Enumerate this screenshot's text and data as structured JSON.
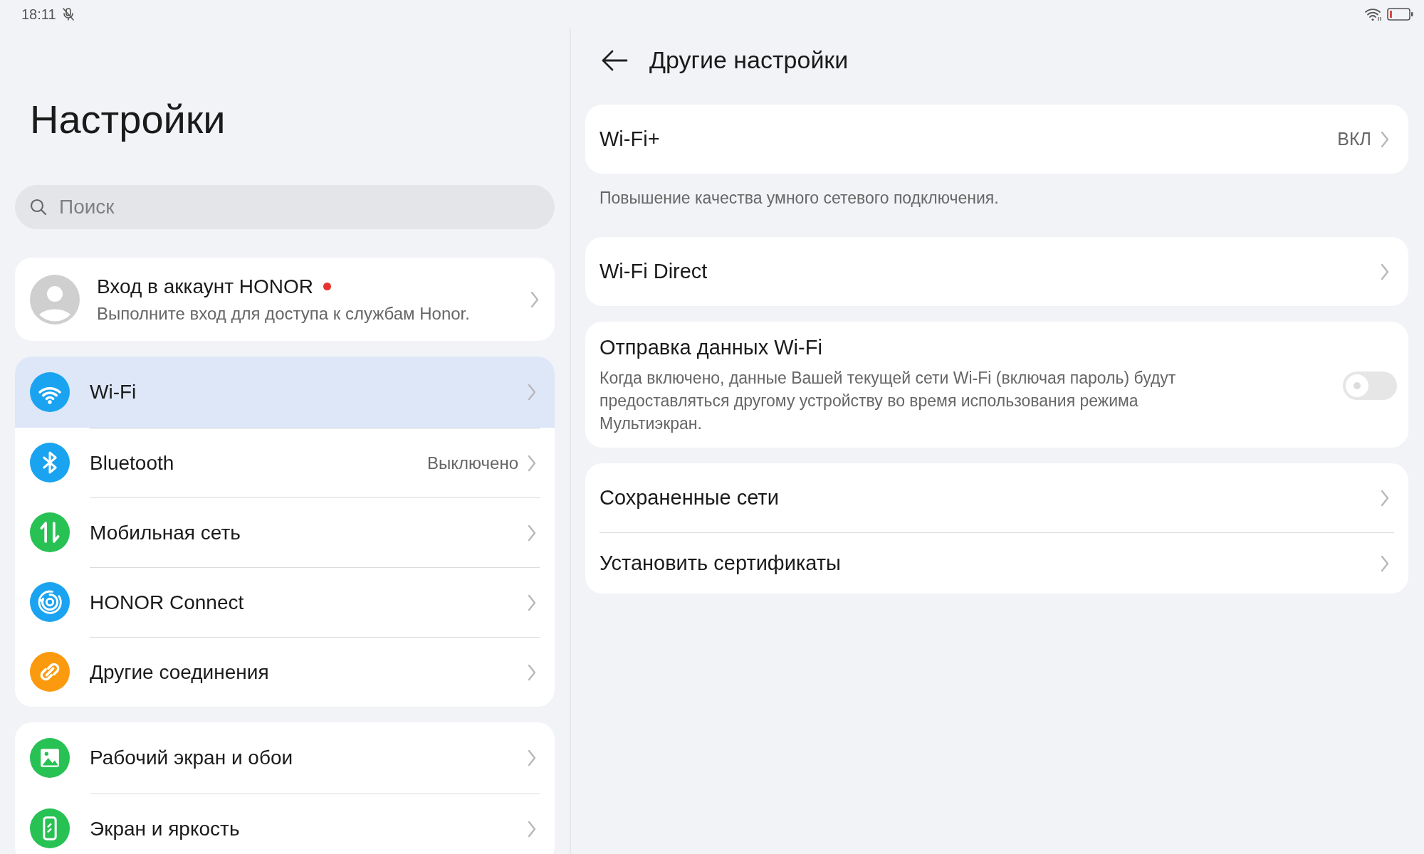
{
  "status_bar": {
    "time": "18:11"
  },
  "sidebar": {
    "title": "Настройки",
    "search": {
      "placeholder": "Поиск"
    },
    "account": {
      "title": "Вход в аккаунт HONOR",
      "subtitle": "Выполните вход для доступа к службам Honor.",
      "notification_dot": true
    },
    "groups": [
      {
        "items": [
          {
            "label": "Wi-Fi",
            "kind": "wifi",
            "color": "#1aa3f0",
            "selected": true
          },
          {
            "label": "Bluetooth",
            "value": "Выключено",
            "kind": "bluetooth",
            "color": "#1aa3f0",
            "selected": false
          },
          {
            "label": "Мобильная сеть",
            "kind": "mobile",
            "color": "#27c154",
            "selected": false
          },
          {
            "label": "HONOR Connect",
            "kind": "connect",
            "color": "#1aa3f0",
            "selected": false
          },
          {
            "label": "Другие соединения",
            "kind": "link",
            "color": "#fb9a0e",
            "selected": false
          }
        ]
      },
      {
        "items": [
          {
            "label": "Рабочий экран и обои",
            "kind": "image",
            "color": "#27c154",
            "selected": false
          },
          {
            "label": "Экран и яркость",
            "kind": "display",
            "color": "#27c154",
            "selected": false
          }
        ]
      }
    ]
  },
  "detail": {
    "title": "Другие настройки",
    "cards": [
      {
        "items": [
          {
            "kind": "link",
            "label": "Wi-Fi+",
            "value": "ВКЛ"
          }
        ],
        "note": "Повышение качества умного сетевого подключения."
      },
      {
        "items": [
          {
            "kind": "link",
            "label": "Wi-Fi Direct"
          }
        ]
      },
      {
        "items": [
          {
            "kind": "toggle",
            "label": "Отправка данных Wi-Fi",
            "description": "Когда включено, данные Вашей текущей сети Wi-Fi (включая пароль) будут предоставляться другому устройству во время использования режима Мультиэкран.",
            "on": false
          }
        ]
      },
      {
        "items": [
          {
            "kind": "link",
            "label": "Сохраненные сети"
          },
          {
            "kind": "link",
            "label": "Установить сертификаты"
          }
        ]
      }
    ]
  }
}
